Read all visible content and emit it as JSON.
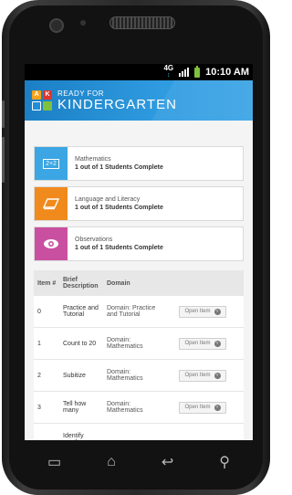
{
  "status": {
    "network": "4G",
    "time": "10:10 AM"
  },
  "header": {
    "brand_top": "READY FOR",
    "brand_main": "KINDERGARTEN",
    "logo_letters": [
      "A",
      "K",
      "",
      ""
    ]
  },
  "cards": [
    {
      "icon": "math-icon",
      "icon_text": "2+2",
      "color": "#3ba6e3",
      "title": "Mathematics",
      "status": "1 out of 1 Students Complete"
    },
    {
      "icon": "book-icon",
      "icon_text": "",
      "color": "#f08a1d",
      "title": "Language and Literacy",
      "status": "1 out of 1 Students Complete"
    },
    {
      "icon": "eye-icon",
      "icon_text": "",
      "color": "#c94fa0",
      "title": "Observations",
      "status": "1 out of 1 Students Complete"
    }
  ],
  "table": {
    "headers": [
      "Item #",
      "Brief Description",
      "Domain"
    ],
    "open_label": "Open Item",
    "rows": [
      {
        "num": "0",
        "desc": "Practice and Tutorial",
        "domain": "Domain: Practice and Tutorial"
      },
      {
        "num": "1",
        "desc": "Count to 20",
        "domain": "Domain: Mathematics"
      },
      {
        "num": "2",
        "desc": "Subitize",
        "domain": "Domain: Mathematics"
      },
      {
        "num": "3",
        "desc": "Tell how many",
        "domain": "Domain: Mathematics"
      },
      {
        "num": "",
        "desc": "Identify number",
        "domain": ""
      }
    ]
  },
  "nav": {
    "recents": "▭",
    "home": "⌂",
    "back": "↩",
    "search": "⚲"
  }
}
